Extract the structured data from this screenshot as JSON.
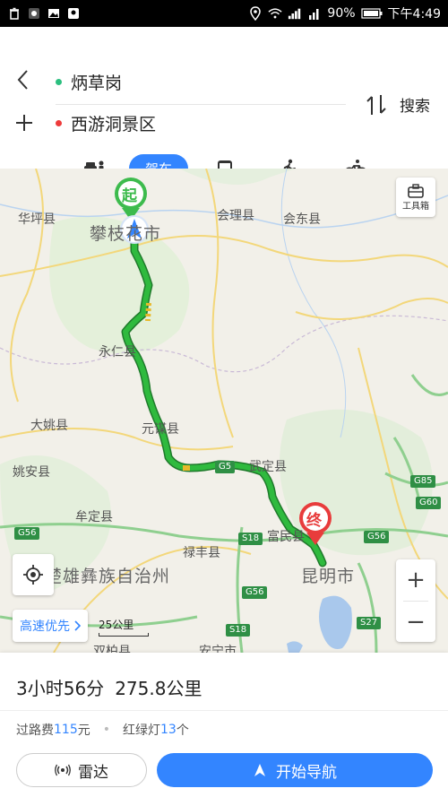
{
  "status_bar": {
    "battery": "90%",
    "time": "下午4:49"
  },
  "route": {
    "from": "炳草岗",
    "to": "西游洞景区",
    "search_label": "搜索",
    "from_color": "#2bbf7f",
    "to_color": "#ee3b3b"
  },
  "modes": {
    "active_label": "驾车",
    "items": [
      "taxi-icon",
      "car-icon",
      "bus-icon",
      "walk-icon",
      "bike-icon"
    ],
    "accent": "#3385ff"
  },
  "map": {
    "start_marker": "起",
    "end_marker": "终",
    "toolbox_label": "工具箱",
    "route_color": "#2fba3e",
    "cities": {
      "huaping": "华坪县",
      "panzhihua": "攀枝花市",
      "huili": "会理县",
      "huidong": "会东县",
      "yongren": "永仁县",
      "dayao": "大姚县",
      "yuanmou": "元谋县",
      "yaoan": "姚安县",
      "wuding": "武定县",
      "mouding": "牟定县",
      "lufeng": "禄丰县",
      "fumin": "富民县",
      "chuxiong": "楚雄彝族自治州",
      "kunming": "昆明市",
      "shuangbai": "双柏县",
      "anning": "安宁市"
    },
    "roads": {
      "g5": "G5",
      "s18a": "S18",
      "s18b": "S18",
      "g56a": "G56",
      "g56b": "G56",
      "g56c": "G56",
      "g85": "G85",
      "g60": "G60",
      "s27": "S27"
    },
    "route_pref": "高速优先",
    "scale": "25公里",
    "zoom_in": "+",
    "zoom_out": "−"
  },
  "summary": {
    "duration": "3小时56分",
    "distance": "275.8公里",
    "toll_label": "过路费",
    "toll_value": "115",
    "toll_unit": "元",
    "lights_label": "红绿灯",
    "lights_value": "13",
    "lights_unit": "个"
  },
  "actions": {
    "radar": "雷达",
    "start_nav": "开始导航"
  }
}
